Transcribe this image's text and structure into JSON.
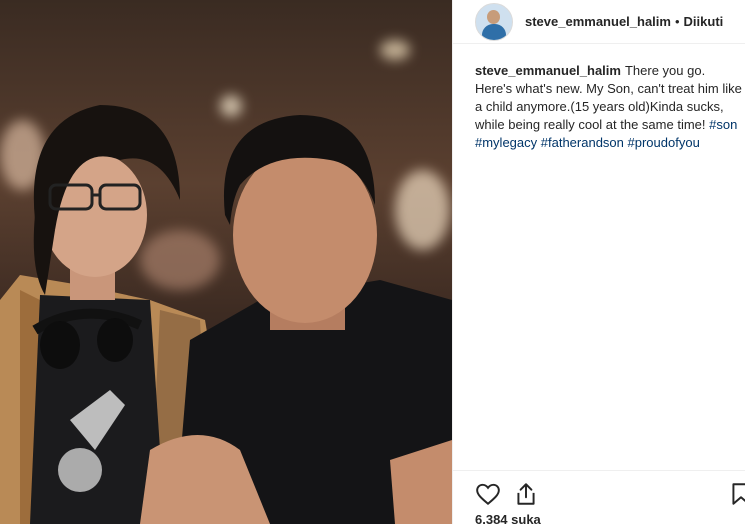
{
  "header": {
    "username": "steve_emmanuel_halim",
    "separator": "•",
    "follow_status": "Diikuti"
  },
  "caption": {
    "username": "steve_emmanuel_halim",
    "text": "There you go. Here's what's new. My Son, can't treat him like a child anymore.(15 years old)Kinda sucks, while being really cool at the same time!",
    "hashtags": [
      "#son",
      "#mylegacy",
      "#fatherandson",
      "#proudofyou"
    ]
  },
  "actions": {
    "icons": [
      "heart-icon",
      "share-icon",
      "bookmark-icon"
    ]
  },
  "likes": {
    "text": "6.384 suka"
  }
}
